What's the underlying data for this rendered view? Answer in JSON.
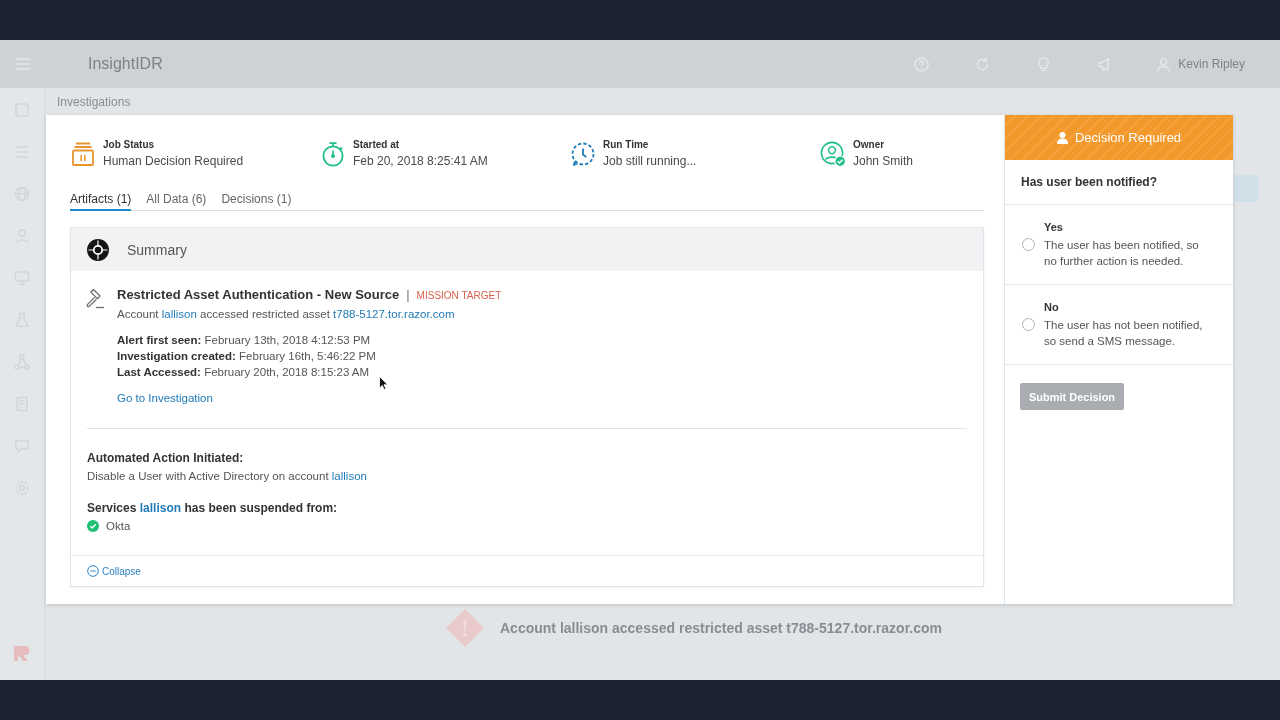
{
  "app": {
    "title": "InsightIDR",
    "user_name": "Kevin Ripley",
    "breadcrumb": "Investigations",
    "background_alert": "Account lallison accessed restricted asset t788-5127.tor.razor.com"
  },
  "job_status": [
    {
      "kind": "status",
      "label": "Job Status",
      "value": "Human Decision Required"
    },
    {
      "kind": "started",
      "label": "Started at",
      "value": "Feb 20, 2018 8:25:41 AM"
    },
    {
      "kind": "runtime",
      "label": "Run Time",
      "value": "Job still running..."
    },
    {
      "kind": "owner",
      "label": "Owner",
      "value": "John Smith"
    }
  ],
  "tabs": [
    {
      "label": "Artifacts (1)",
      "selected": true
    },
    {
      "label": "All Data (6)",
      "selected": false
    },
    {
      "label": "Decisions (1)",
      "selected": false
    }
  ],
  "summary": {
    "title": "Summary",
    "alert": {
      "title": "Restricted Asset Authentication - New Source",
      "separator": "|",
      "tag": "MISSION TARGET",
      "description": [
        {
          "kind": "text",
          "text": "Account "
        },
        {
          "kind": "link",
          "text": "lallison"
        },
        {
          "kind": "text",
          "text": " accessed restricted asset "
        },
        {
          "kind": "link",
          "text": "t788-5127.tor.razor.com"
        }
      ],
      "details": [
        "**Alert first seen:** February 13th, 2018 4:12:53 PM",
        "**Investigation created:** February 16th, 5:46:22 PM",
        "**Last Accessed:** February 20th, 2018 8:15:23 AM"
      ],
      "link": "Go to Investigation"
    },
    "action": {
      "heading": "Automated Action Initiated:",
      "description": [
        {
          "kind": "text",
          "text": "Disable a User with Active Directory on account "
        },
        {
          "kind": "link",
          "text": "lallison"
        }
      ]
    },
    "services": {
      "heading": [
        {
          "kind": "text",
          "text": "Services "
        },
        {
          "kind": "link",
          "text": "lallison"
        },
        {
          "kind": "text",
          "text": " has been suspended from:"
        }
      ],
      "items": [
        {
          "name": "Okta",
          "suspended": true
        }
      ]
    },
    "collapse": "Collapse"
  },
  "decision": {
    "title": "Decision Required",
    "question": "Has user been notified?",
    "options": [
      {
        "label": "Yes",
        "description": "The user has been notified, so no further action is needed.",
        "selected": false
      },
      {
        "label": "No",
        "description": "The user has not been notified, so send a SMS message.",
        "selected": false
      }
    ],
    "submit": {
      "label": "Submit Decision",
      "disabled": true
    }
  }
}
